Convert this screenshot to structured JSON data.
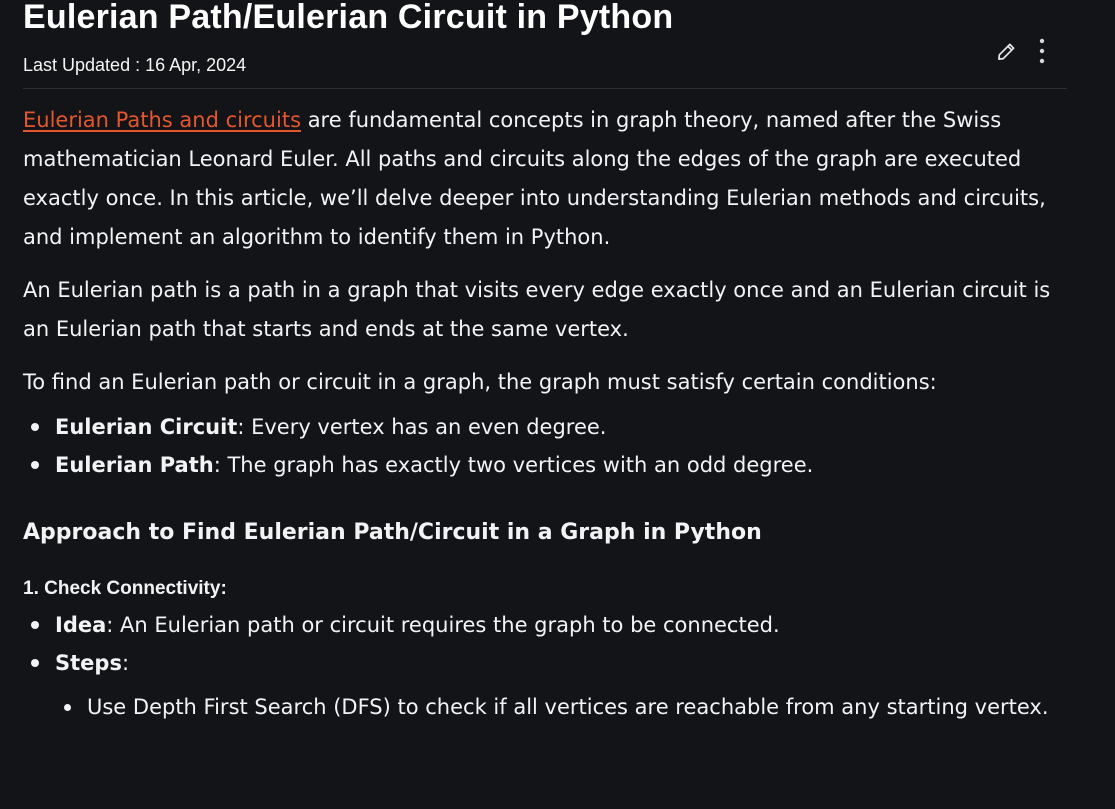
{
  "article": {
    "title": "Eulerian Path/Eulerian Circuit in Python",
    "last_updated": "Last Updated : 16 Apr, 2024",
    "actions": {
      "edit_icon": "pencil-icon",
      "more_icon": "vertical-dots-icon"
    },
    "intro": {
      "link_text": "Eulerian Paths and circuits",
      "rest": " are fundamental concepts in graph theory, named after the Swiss mathematician Leonard Euler. All paths and circuits along the edges of the graph are executed exactly once. In this article, we’ll delve deeper into understanding Eulerian methods and circuits, and implement an algorithm to identify them in Python."
    },
    "para2": "An Eulerian path is a path in a graph that visits every edge exactly once and an Eulerian circuit is an Eulerian path that starts and ends at the same vertex.",
    "para3": "To find an Eulerian path or circuit in a graph, the graph must satisfy certain conditions:",
    "conditions": [
      {
        "term": "Eulerian Circuit",
        "desc": ": Every vertex has an even degree."
      },
      {
        "term": "Eulerian Path",
        "desc": ": The graph has exactly two vertices with an odd degree."
      }
    ],
    "section_heading": "Approach to Find Eulerian Path/Circuit in a Graph in Python",
    "step1": {
      "heading": "1. Check Connectivity:",
      "items": [
        {
          "term": "Idea",
          "desc": ": An Eulerian path or circuit requires the graph to be connected."
        },
        {
          "term": "Steps",
          "desc": ":"
        }
      ],
      "sub_items": [
        "Use Depth First Search (DFS) to check if all vertices are reachable from any starting vertex."
      ]
    }
  },
  "colors": {
    "background": "#131417",
    "text": "#f2f3f5",
    "link": "#e4572e",
    "divider": "#2c2f34"
  }
}
